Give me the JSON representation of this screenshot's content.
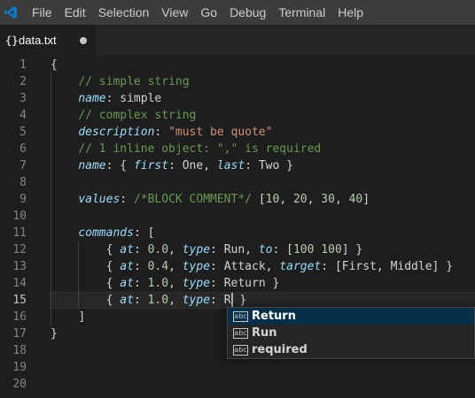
{
  "menubar": {
    "logo_icon": "vscode-logo-icon",
    "items": [
      "File",
      "Edit",
      "Selection",
      "View",
      "Go",
      "Debug",
      "Terminal",
      "Help"
    ]
  },
  "tabs": [
    {
      "icon": "braces-icon",
      "icon_glyph": "{}",
      "label": "data.txt",
      "dirty": true
    }
  ],
  "editor": {
    "current_line": 15,
    "line_numbers": [
      "1",
      "2",
      "3",
      "4",
      "5",
      "6",
      "7",
      "8",
      "9",
      "10",
      "11",
      "12",
      "13",
      "14",
      "15",
      "16",
      "17",
      "18",
      "19",
      "20"
    ],
    "lines": [
      [
        {
          "t": "{",
          "c": "punct"
        }
      ],
      [
        {
          "t": "    "
        },
        {
          "t": "// simple string",
          "c": "comment"
        }
      ],
      [
        {
          "t": "    "
        },
        {
          "t": "name",
          "c": "key"
        },
        {
          "t": ": ",
          "c": "punct"
        },
        {
          "t": "simple",
          "c": "val"
        }
      ],
      [
        {
          "t": "    "
        },
        {
          "t": "// complex string",
          "c": "comment"
        }
      ],
      [
        {
          "t": "    "
        },
        {
          "t": "description",
          "c": "key"
        },
        {
          "t": ": ",
          "c": "punct"
        },
        {
          "t": "\"must be quote\"",
          "c": "str"
        }
      ],
      [
        {
          "t": "    "
        },
        {
          "t": "// 1 inline object: \",\" is required",
          "c": "comment"
        }
      ],
      [
        {
          "t": "    "
        },
        {
          "t": "name",
          "c": "key"
        },
        {
          "t": ": { ",
          "c": "punct"
        },
        {
          "t": "first",
          "c": "key"
        },
        {
          "t": ": ",
          "c": "punct"
        },
        {
          "t": "One",
          "c": "val"
        },
        {
          "t": ", ",
          "c": "punct"
        },
        {
          "t": "last",
          "c": "key"
        },
        {
          "t": ": ",
          "c": "punct"
        },
        {
          "t": "Two",
          "c": "val"
        },
        {
          "t": " }",
          "c": "punct"
        }
      ],
      [],
      [
        {
          "t": "    "
        },
        {
          "t": "values",
          "c": "key"
        },
        {
          "t": ": ",
          "c": "punct"
        },
        {
          "t": "/*BLOCK COMMENT*/",
          "c": "comment"
        },
        {
          "t": " [",
          "c": "punct"
        },
        {
          "t": "10",
          "c": "num"
        },
        {
          "t": ", ",
          "c": "punct"
        },
        {
          "t": "20",
          "c": "num"
        },
        {
          "t": ", ",
          "c": "punct"
        },
        {
          "t": "30",
          "c": "num"
        },
        {
          "t": ", ",
          "c": "punct"
        },
        {
          "t": "40",
          "c": "num"
        },
        {
          "t": "]",
          "c": "punct"
        }
      ],
      [],
      [
        {
          "t": "    "
        },
        {
          "t": "commands",
          "c": "key"
        },
        {
          "t": ": [",
          "c": "punct"
        }
      ],
      [
        {
          "t": "        "
        },
        {
          "t": "{ ",
          "c": "punct"
        },
        {
          "t": "at",
          "c": "key"
        },
        {
          "t": ": ",
          "c": "punct"
        },
        {
          "t": "0.0",
          "c": "num"
        },
        {
          "t": ", ",
          "c": "punct"
        },
        {
          "t": "type",
          "c": "key"
        },
        {
          "t": ": ",
          "c": "punct"
        },
        {
          "t": "Run",
          "c": "val"
        },
        {
          "t": ", ",
          "c": "punct"
        },
        {
          "t": "to",
          "c": "key"
        },
        {
          "t": ": [",
          "c": "punct"
        },
        {
          "t": "100",
          "c": "num"
        },
        {
          "t": " ",
          "c": "punct"
        },
        {
          "t": "100",
          "c": "num"
        },
        {
          "t": "] }",
          "c": "punct"
        }
      ],
      [
        {
          "t": "        "
        },
        {
          "t": "{ ",
          "c": "punct"
        },
        {
          "t": "at",
          "c": "key"
        },
        {
          "t": ": ",
          "c": "punct"
        },
        {
          "t": "0.4",
          "c": "num"
        },
        {
          "t": ", ",
          "c": "punct"
        },
        {
          "t": "type",
          "c": "key"
        },
        {
          "t": ": ",
          "c": "punct"
        },
        {
          "t": "Attack",
          "c": "val"
        },
        {
          "t": ", ",
          "c": "punct"
        },
        {
          "t": "target",
          "c": "key"
        },
        {
          "t": ": [",
          "c": "punct"
        },
        {
          "t": "First",
          "c": "val"
        },
        {
          "t": ", ",
          "c": "punct"
        },
        {
          "t": "Middle",
          "c": "val"
        },
        {
          "t": "] }",
          "c": "punct"
        }
      ],
      [
        {
          "t": "        "
        },
        {
          "t": "{ ",
          "c": "punct"
        },
        {
          "t": "at",
          "c": "key"
        },
        {
          "t": ": ",
          "c": "punct"
        },
        {
          "t": "1.0",
          "c": "num"
        },
        {
          "t": ", ",
          "c": "punct"
        },
        {
          "t": "type",
          "c": "key"
        },
        {
          "t": ": ",
          "c": "punct"
        },
        {
          "t": "Return",
          "c": "val"
        },
        {
          "t": " }",
          "c": "punct"
        }
      ],
      [
        {
          "t": "        "
        },
        {
          "t": "{ ",
          "c": "punct"
        },
        {
          "t": "at",
          "c": "key"
        },
        {
          "t": ": ",
          "c": "punct"
        },
        {
          "t": "1.0",
          "c": "num"
        },
        {
          "t": ", ",
          "c": "punct"
        },
        {
          "t": "type",
          "c": "key"
        },
        {
          "t": ": ",
          "c": "punct"
        },
        {
          "t": "R",
          "c": "val"
        },
        {
          "cursor": true
        },
        {
          "t": " }",
          "c": "punct"
        }
      ],
      [
        {
          "t": "    "
        },
        {
          "t": "]",
          "c": "punct"
        }
      ],
      [
        {
          "t": "}",
          "c": "punct"
        }
      ],
      [],
      [],
      []
    ]
  },
  "suggest": {
    "kind_icon": "text-suggestion-icon",
    "kind_label": "abc",
    "items": [
      {
        "label": "Return",
        "selected": true
      },
      {
        "label": "Run",
        "selected": false
      },
      {
        "label": "required",
        "selected": false
      }
    ]
  },
  "colors": {
    "background": "#1e1e1e",
    "menubar": "#3c3c3c",
    "accent_logo": "#0a7acc",
    "comment": "#6a9955",
    "key": "#9cdcfe",
    "string": "#ce9178",
    "number": "#b5cea8",
    "suggest_selected": "#062f4a"
  }
}
